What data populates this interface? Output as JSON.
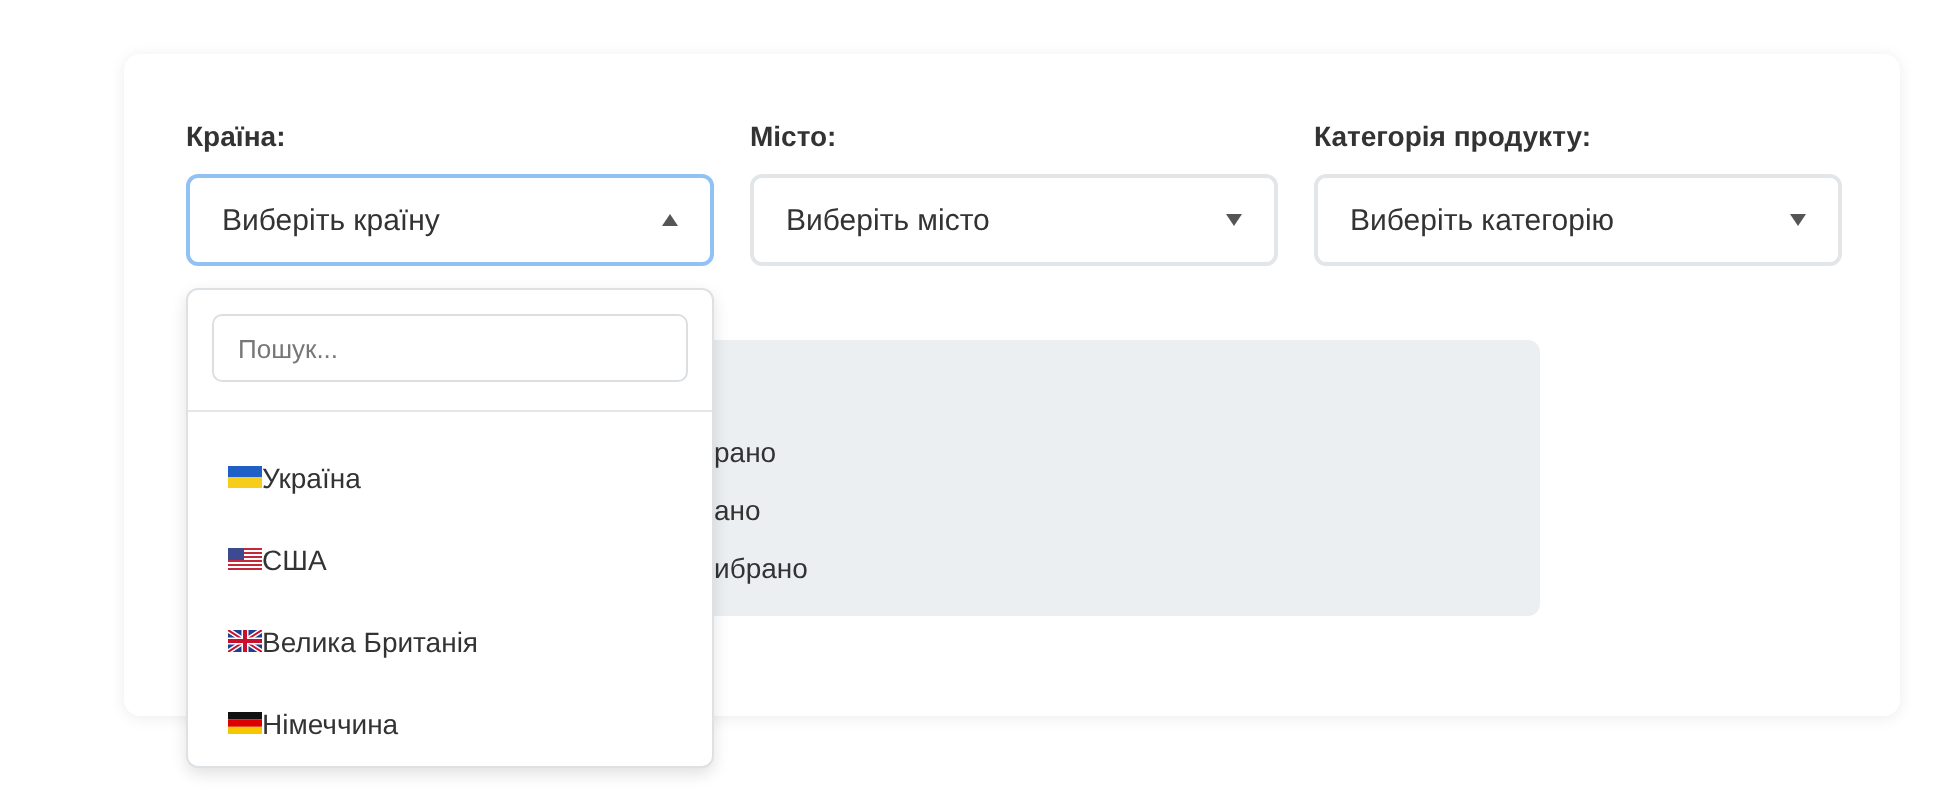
{
  "filters": [
    {
      "label": "Країна:",
      "placeholder": "Виберіть країну",
      "open": true
    },
    {
      "label": "Місто:",
      "placeholder": "Виберіть місто",
      "open": false
    },
    {
      "label": "Категорія продукту:",
      "placeholder": "Виберіть категорію",
      "open": false
    }
  ],
  "summary": {
    "lines": [
      "рано",
      "ано",
      "ибрано"
    ]
  },
  "dropdown": {
    "search": {
      "placeholder": "Пошук..."
    },
    "options": [
      {
        "kind": "ua",
        "label": "Україна"
      },
      {
        "kind": "us",
        "label": "США"
      },
      {
        "kind": "gb",
        "label": "Велика Британія"
      },
      {
        "kind": "de",
        "label": "Німеччина"
      }
    ]
  }
}
